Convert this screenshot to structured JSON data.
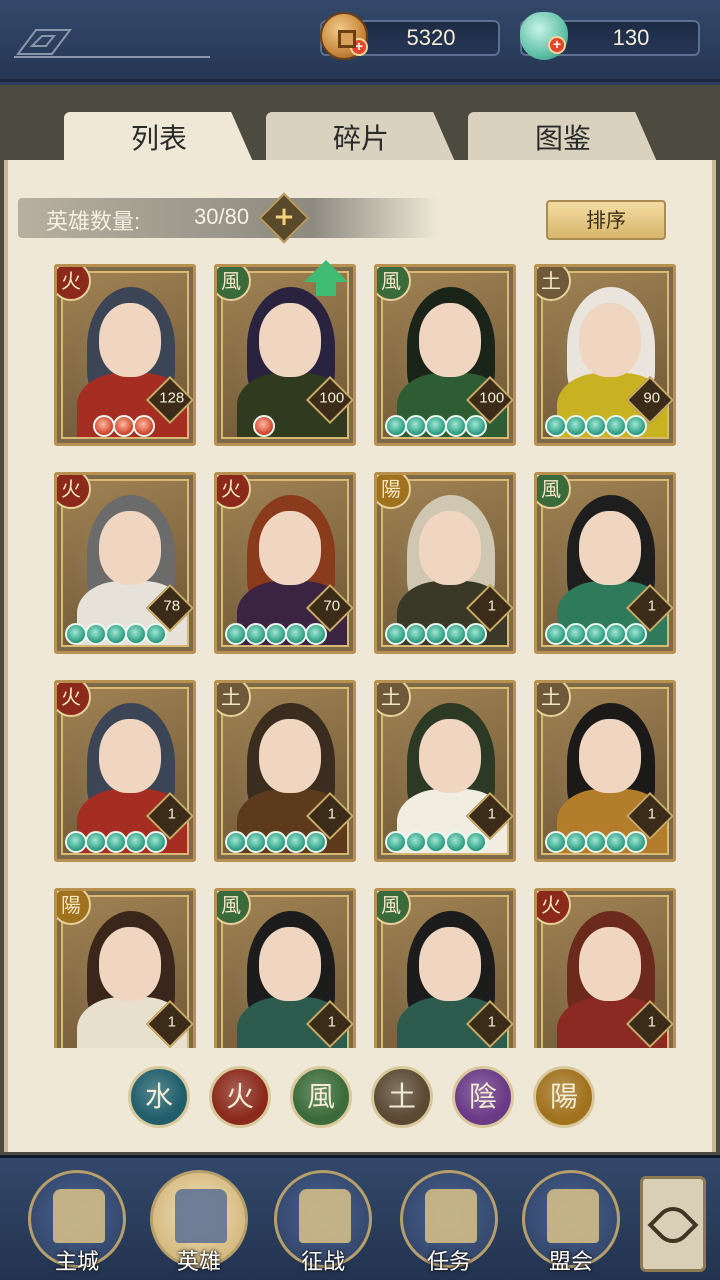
{
  "currencies": {
    "coins": {
      "value": "5320",
      "icon": "copper-coin-icon"
    },
    "jade": {
      "value": "130",
      "icon": "jade-icon"
    }
  },
  "tabs": [
    {
      "label": "列表",
      "active": true
    },
    {
      "label": "碎片",
      "active": false
    },
    {
      "label": "图鉴",
      "active": false
    }
  ],
  "hero_count": {
    "label": "英雄数量:",
    "value": "30/80"
  },
  "sort_label": "排序",
  "heroes": [
    {
      "element": "火",
      "color": "#8b2a1c",
      "level": "128",
      "stars": 3,
      "star_color": "red",
      "hair": "#3b4556",
      "body": "#a52d22"
    },
    {
      "element": "風",
      "color": "#3b6b3a",
      "level": "100",
      "stars": 1,
      "star_color": "red",
      "hair": "#2a2340",
      "body": "#2f3a1f",
      "upgrade": true
    },
    {
      "element": "風",
      "color": "#3b6b3a",
      "level": "100",
      "stars": 5,
      "star_color": "green",
      "hair": "#1a2418",
      "body": "#2f5d33"
    },
    {
      "element": "土",
      "color": "#6e5a3a",
      "level": "90",
      "stars": 5,
      "star_color": "green",
      "hair": "#e9e4dc",
      "body": "#c8b221"
    },
    {
      "element": "火",
      "color": "#8b2a1c",
      "level": "78",
      "stars": 5,
      "star_color": "green",
      "hair": "#6b6b6b",
      "body": "#e6e2da"
    },
    {
      "element": "火",
      "color": "#8b2a1c",
      "level": "70",
      "stars": 5,
      "star_color": "green",
      "hair": "#8a3b1c",
      "body": "#3b2342"
    },
    {
      "element": "陽",
      "color": "#a0721d",
      "level": "1",
      "stars": 5,
      "star_color": "green",
      "hair": "#cfc7b2",
      "body": "#3a3826"
    },
    {
      "element": "風",
      "color": "#3b6b3a",
      "level": "1",
      "stars": 5,
      "star_color": "green",
      "hair": "#1e1e1e",
      "body": "#2e7a5b"
    },
    {
      "element": "火",
      "color": "#8b2a1c",
      "level": "1",
      "stars": 5,
      "star_color": "green",
      "hair": "#3b4556",
      "body": "#a52d22"
    },
    {
      "element": "土",
      "color": "#6e5a3a",
      "level": "1",
      "stars": 5,
      "star_color": "green",
      "hair": "#3a2c1e",
      "body": "#5e3a1c"
    },
    {
      "element": "土",
      "color": "#6e5a3a",
      "level": "1",
      "stars": 5,
      "star_color": "green",
      "hair": "#2c3a25",
      "body": "#f2ede1"
    },
    {
      "element": "土",
      "color": "#6e5a3a",
      "level": "1",
      "stars": 5,
      "star_color": "green",
      "hair": "#1c1a18",
      "body": "#b37d2c"
    },
    {
      "element": "陽",
      "color": "#a0721d",
      "level": "1",
      "stars": 0,
      "star_color": "green",
      "hair": "#3a261a",
      "body": "#e8e0cc"
    },
    {
      "element": "風",
      "color": "#3b6b3a",
      "level": "1",
      "stars": 0,
      "star_color": "green",
      "hair": "#1c1c1c",
      "body": "#2d5b4d"
    },
    {
      "element": "風",
      "color": "#3b6b3a",
      "level": "1",
      "stars": 0,
      "star_color": "green",
      "hair": "#1c1c1c",
      "body": "#2d5b4d"
    },
    {
      "element": "火",
      "color": "#8b2a1c",
      "level": "1",
      "stars": 0,
      "star_color": "green",
      "hair": "#6b2a1c",
      "body": "#8a2a22"
    }
  ],
  "element_filters": [
    {
      "glyph": "水",
      "color": "#1f5e6a"
    },
    {
      "glyph": "火",
      "color": "#8b2a1c"
    },
    {
      "glyph": "風",
      "color": "#3b6b3a"
    },
    {
      "glyph": "土",
      "color": "#5a4a33"
    },
    {
      "glyph": "陰",
      "color": "#6a3a86"
    },
    {
      "glyph": "陽",
      "color": "#a0721d"
    }
  ],
  "nav": [
    {
      "label": "主城",
      "active": false
    },
    {
      "label": "英雄",
      "active": true
    },
    {
      "label": "征战",
      "active": false
    },
    {
      "label": "任务",
      "active": false
    },
    {
      "label": "盟会",
      "active": false
    }
  ]
}
